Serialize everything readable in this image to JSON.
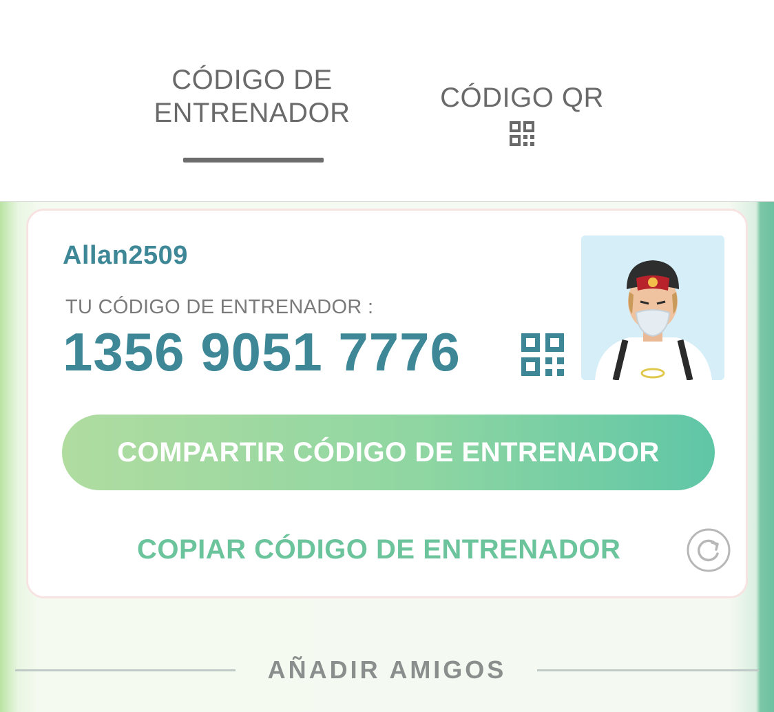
{
  "tabs": {
    "trainer_code_line1": "CÓDIGO DE",
    "trainer_code_line2": "ENTRENADOR",
    "qr_code": "CÓDIGO QR",
    "qr_icon": "qr-code-icon"
  },
  "card": {
    "username": "Allan2509",
    "code_label": "TU CÓDIGO DE ENTRENADOR :",
    "code_value": "1356 9051 7776",
    "share_button": "COMPARTIR CÓDIGO DE ENTRENADOR",
    "copy_link": "COPIAR CÓDIGO DE ENTRENADOR",
    "icons": [
      "qr-code-icon",
      "avatar",
      "refresh-icon"
    ]
  },
  "section": {
    "add_friends": "AÑADIR AMIGOS"
  },
  "colors": {
    "accent_teal": "#3d8797",
    "copy_green": "#6cc49c",
    "button_gradient_start": "#b0dca0",
    "button_gradient_end": "#5fc6a6",
    "tab_text": "#6a6a6a"
  }
}
